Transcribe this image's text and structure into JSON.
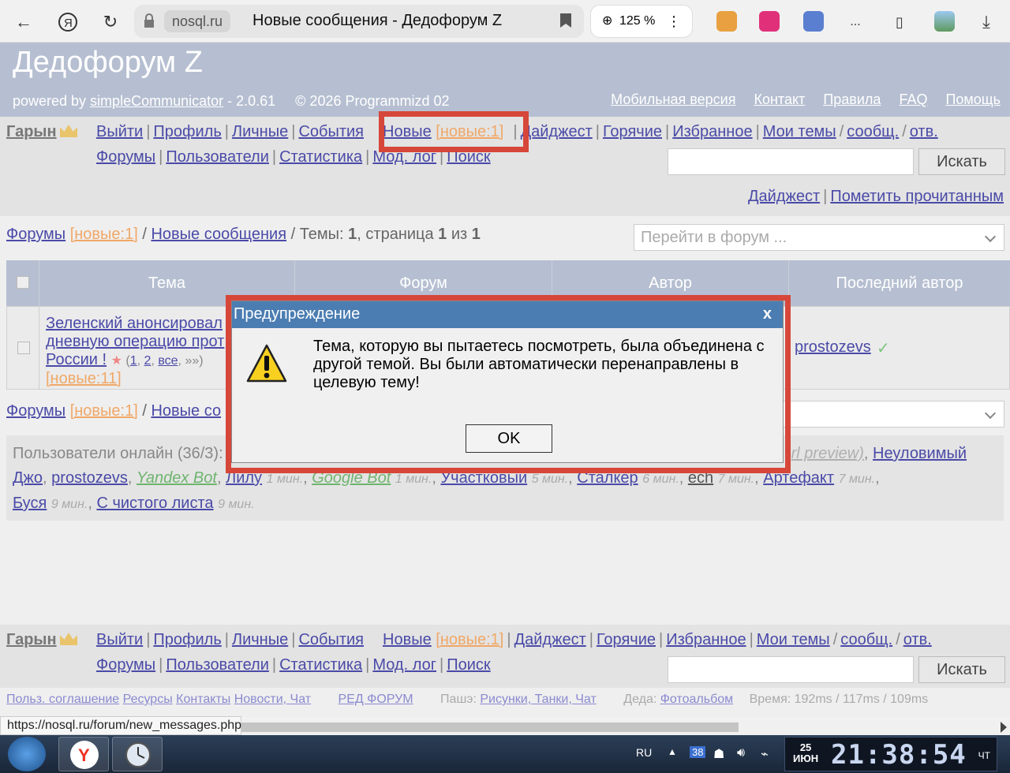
{
  "browser": {
    "host": "nosql.ru",
    "tab_title": "Новые сообщения - Дедофорум Z",
    "zoom": "125 %",
    "more": "...",
    "status_url": "https://nosql.ru/forum/new_messages.php"
  },
  "header": {
    "site_title": "Дедофорум Z",
    "powered_prefix": "powered by ",
    "powered_link": "simpleCommunicator",
    "powered_suffix": " - 2.0.61     © 2026 Programmizd 02",
    "links": [
      "Мобильная версия",
      "Контакт",
      "Правила",
      "FAQ",
      "Помощь"
    ]
  },
  "nav": {
    "user": "Гарын",
    "row1": [
      "Выйти",
      "Профиль",
      "Личные",
      "События",
      "Новые",
      "[новые:1]",
      "Дайджест",
      "Горячие",
      "Избранное",
      "Мои темы",
      "сообщ.",
      "отв."
    ],
    "row2": [
      "Форумы",
      "Пользователи",
      "Статистика",
      "Мод. лог",
      "Поиск"
    ],
    "search_button": "Искать"
  },
  "actions": {
    "digest": "Дайджест",
    "mark_read": "Пометить прочитанным"
  },
  "breadcrumb": {
    "forums": "Форумы",
    "new_count": "[новые:1]",
    "new_messages": "Новые сообщения",
    "topics_label": " / Темы: ",
    "topics_count": "1",
    "page_label": ", страница ",
    "page": "1",
    "of_label": " из ",
    "pages": "1",
    "new_messages_short": "Новые со",
    "jump_placeholder": "Перейти в форум ..."
  },
  "table": {
    "headers": [
      "Тема",
      "Форум",
      "Автор",
      "Последний автор"
    ],
    "row": {
      "topic_lines": [
        "Зеленский анонсировал",
        "дневную операцию прот",
        "России !"
      ],
      "pages_open": " (",
      "page_links": [
        "1",
        "2",
        "все"
      ],
      "pages_more": "»»)",
      "new_count": "[новые:11]",
      "last_author": "prostozevs",
      "check": "✓"
    }
  },
  "online": {
    "label": "Пользователи онлайн (36/3):",
    "hidden_tail": "rl preview)",
    "sep": ",",
    "users": [
      {
        "name": "Неуловимый",
        "type": "link"
      },
      {
        "name": "Джо",
        "type": "link"
      },
      {
        "name": "prostozevs",
        "type": "link"
      },
      {
        "name": "Yandex Bot",
        "type": "bot"
      },
      {
        "name": "Лилу",
        "type": "link",
        "time": "1 мин."
      },
      {
        "name": "Google Bot",
        "type": "bot",
        "time": "1 мин."
      },
      {
        "name": "Участковый",
        "type": "link",
        "time": "5 мин."
      },
      {
        "name": "Сталкер",
        "type": "link",
        "time": "6 мин."
      },
      {
        "name": "ech",
        "type": "link",
        "time": "7 мин."
      },
      {
        "name": "Артефакт",
        "type": "link",
        "time": "7 мин."
      },
      {
        "name": "Буся",
        "type": "link",
        "time": "9 мин."
      },
      {
        "name": "С чистого листа",
        "type": "link",
        "time": "9 мин."
      }
    ]
  },
  "footer": {
    "text1": "Польз. соглашение",
    "text2": "Ресурсы",
    "text3": "Контакты",
    "text4": "Новости, Чат",
    "red": "РЕД ФОРУМ",
    "pashe": "Пашэ:",
    "pashe_links": "Рисунки, Танки, Чат",
    "deda": "Деда:",
    "deda_links": "Фотоальбом",
    "stats": "Время: 192ms / 117ms / 109ms"
  },
  "dialog": {
    "title": "Предупреждение",
    "close": "x",
    "message": "Тема, которую вы пытаетесь посмотреть, была объединена с другой темой. Вы были автоматически перенаправлены в целевую тему!",
    "ok": "OK"
  },
  "taskbar": {
    "lang": "RU",
    "tray_num": "38",
    "date_day": "25",
    "date_month": "ИЮН",
    "time": "21:38:54",
    "weekday": "ЧТ"
  },
  "colors": {
    "header_bg": "#b6bfd1",
    "link": "#4a4aa8",
    "new_badge": "#f0a868",
    "highlight": "#d6473a",
    "dialog_title": "#4b7db2"
  }
}
